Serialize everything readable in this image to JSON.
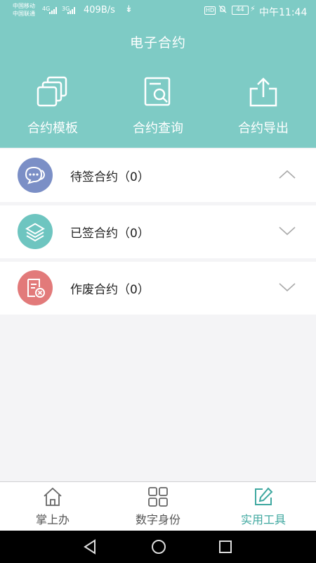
{
  "status_bar": {
    "carrier_1": "中国移动",
    "carrier_2": "中国联通",
    "network_1": "4G",
    "network_2": "3G",
    "speed": "409B/s",
    "hd": "HD",
    "battery": "44",
    "time": "中午11:44"
  },
  "header": {
    "title": "电子合约",
    "tools": [
      {
        "label": "合约模板",
        "icon": "template-icon"
      },
      {
        "label": "合约查询",
        "icon": "search-document-icon"
      },
      {
        "label": "合约导出",
        "icon": "export-icon"
      }
    ],
    "colors": {
      "header_bg": "#7ecbc5"
    }
  },
  "sections": [
    {
      "label": "待签合约（0）",
      "icon": "chat-bubble-icon",
      "color": "#7b8fc6",
      "expanded": true
    },
    {
      "label": "已签合约（0）",
      "icon": "layers-icon",
      "color": "#6ec5c0",
      "expanded": false
    },
    {
      "label": "作废合约（0）",
      "icon": "void-document-icon",
      "color": "#e27a7a",
      "expanded": false
    }
  ],
  "tab_bar": {
    "tabs": [
      {
        "label": "掌上办",
        "icon": "home-icon",
        "active": false
      },
      {
        "label": "数字身份",
        "icon": "grid-icon",
        "active": false
      },
      {
        "label": "实用工具",
        "icon": "edit-icon",
        "active": true
      }
    ],
    "active_color": "#3fa8a0"
  }
}
